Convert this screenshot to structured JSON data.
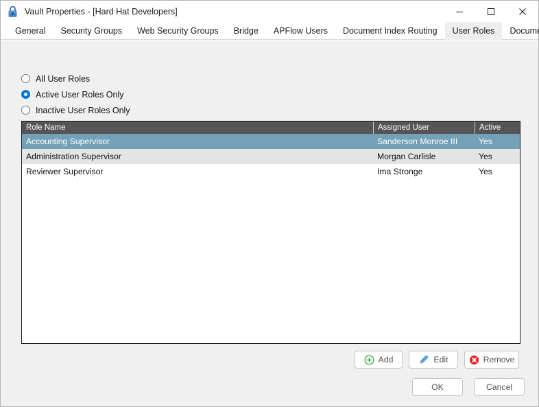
{
  "window": {
    "title": "Vault Properties - [Hard Hat Developers]",
    "icon": "lock-icon",
    "controls": {
      "minimize": "minimize-icon",
      "maximize": "maximize-icon",
      "close": "close-icon"
    }
  },
  "tabs": [
    {
      "label": "General",
      "active": false
    },
    {
      "label": "Security Groups",
      "active": false
    },
    {
      "label": "Web Security Groups",
      "active": false
    },
    {
      "label": "Bridge",
      "active": false
    },
    {
      "label": "APFlow Users",
      "active": false
    },
    {
      "label": "Document Index Routing",
      "active": false
    },
    {
      "label": "User Roles",
      "active": true
    },
    {
      "label": "Document Publishing",
      "active": false
    }
  ],
  "filter": {
    "options": [
      {
        "label": "All User Roles",
        "checked": false
      },
      {
        "label": "Active User Roles Only",
        "checked": true
      },
      {
        "label": "Inactive User Roles Only",
        "checked": false
      }
    ]
  },
  "list": {
    "columns": [
      {
        "label": "Role Name"
      },
      {
        "label": "Assigned User"
      },
      {
        "label": "Active"
      }
    ],
    "rows": [
      {
        "role_name": "Accounting Supervisor",
        "assigned_user": "Sanderson Monroe III",
        "active": "Yes"
      },
      {
        "role_name": "Administration Supervisor",
        "assigned_user": "Morgan Carlisle",
        "active": "Yes"
      },
      {
        "role_name": "Reviewer Supervisor",
        "assigned_user": "Ima Stronge",
        "active": "Yes"
      }
    ]
  },
  "actions": {
    "add_label": "Add",
    "add_icon": "circle-plus-icon",
    "edit_label": "Edit",
    "edit_icon": "pencil-icon",
    "remove_label": "Remove",
    "remove_icon": "circle-x-icon"
  },
  "footer": {
    "ok_label": "OK",
    "cancel_label": "Cancel"
  },
  "colors": {
    "accent": "#0078d7",
    "header_bar": "#555555",
    "selection": "#74a0b8",
    "alt_row": "#e4e4e4",
    "dialog_bg": "#f0f0f0",
    "add_green": "#4caf50",
    "edit_blue": "#3d9ae8",
    "remove_red": "#e8202a"
  }
}
